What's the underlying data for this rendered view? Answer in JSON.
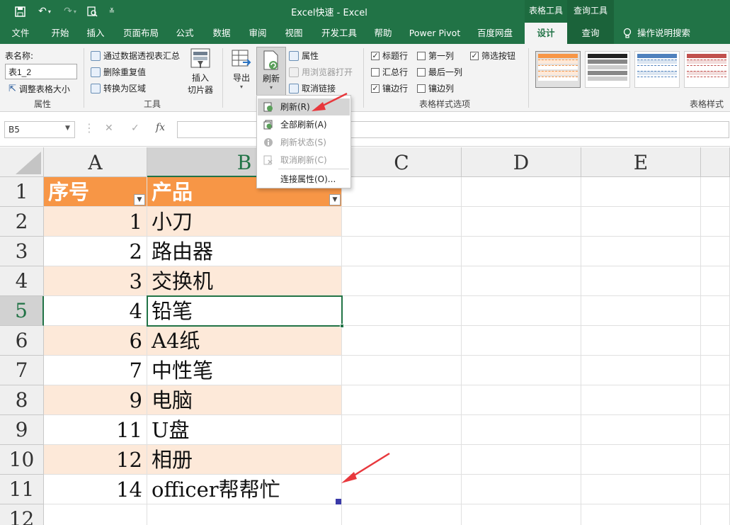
{
  "title_bar": {
    "app_title": "Excel快速  -  Excel",
    "context_groups": [
      "表格工具",
      "查询工具"
    ]
  },
  "tabs": [
    {
      "label": "文件"
    },
    {
      "label": "开始"
    },
    {
      "label": "插入"
    },
    {
      "label": "页面布局"
    },
    {
      "label": "公式"
    },
    {
      "label": "数据"
    },
    {
      "label": "审阅"
    },
    {
      "label": "视图"
    },
    {
      "label": "开发工具"
    },
    {
      "label": "帮助"
    },
    {
      "label": "Power Pivot"
    },
    {
      "label": "百度网盘"
    },
    {
      "label": "设计"
    },
    {
      "label": "查询"
    }
  ],
  "tell_me": "操作说明搜索",
  "ribbon": {
    "properties": {
      "table_name_label": "表名称:",
      "table_name_value": "表1_2",
      "resize_label": "调整表格大小",
      "group_label": "属性"
    },
    "tools": {
      "pivot_label": "通过数据透视表汇总",
      "remove_dup_label": "删除重复值",
      "convert_label": "转换为区域",
      "slicer_line1": "插入",
      "slicer_line2": "切片器",
      "group_label": "工具"
    },
    "external": {
      "export_label": "导出",
      "refresh_label": "刷新",
      "properties_label": "属性",
      "open_browser_label": "用浏览器打开",
      "unlink_label": "取消链接"
    },
    "style_options": {
      "header_row": "标题行",
      "first_column": "第一列",
      "filter_button": "筛选按钮",
      "total_row": "汇总行",
      "last_column": "最后一列",
      "banded_rows": "镶边行",
      "banded_columns": "镶边列",
      "group_label": "表格样式选项"
    },
    "table_styles": {
      "group_label": "表格样式"
    }
  },
  "formula_bar": {
    "name_box": "B5",
    "fx": "fx",
    "cancel": "✕",
    "enter": "✓",
    "formula": ""
  },
  "refresh_menu": {
    "items": [
      {
        "label": "刷新(R)"
      },
      {
        "label": "全部刷新(A)"
      },
      {
        "label": "刷新状态(S)"
      },
      {
        "label": "取消刷新(C)"
      },
      {
        "label": "连接属性(O)..."
      }
    ]
  },
  "sheet": {
    "columns": [
      "A",
      "B",
      "C",
      "D",
      "E"
    ],
    "rows": [
      "1",
      "2",
      "3",
      "4",
      "5",
      "6",
      "7",
      "8",
      "9",
      "10",
      "11",
      "12"
    ],
    "header": {
      "a": "序号",
      "b": "产品"
    },
    "data": [
      {
        "a": "1",
        "b": "小刀"
      },
      {
        "a": "2",
        "b": "路由器"
      },
      {
        "a": "3",
        "b": "交换机"
      },
      {
        "a": "4",
        "b": "铅笔"
      },
      {
        "a": "6",
        "b": "A4纸"
      },
      {
        "a": "7",
        "b": "中性笔"
      },
      {
        "a": "9",
        "b": "电脑"
      },
      {
        "a": "11",
        "b": "U盘"
      },
      {
        "a": "12",
        "b": "相册"
      },
      {
        "a": "14",
        "b": "officer帮帮忙"
      }
    ]
  },
  "colors": {
    "excel_green": "#217346",
    "table_header": "#f79646",
    "table_band": "#fde9d9",
    "annotation_arrow": "#e8383d"
  }
}
